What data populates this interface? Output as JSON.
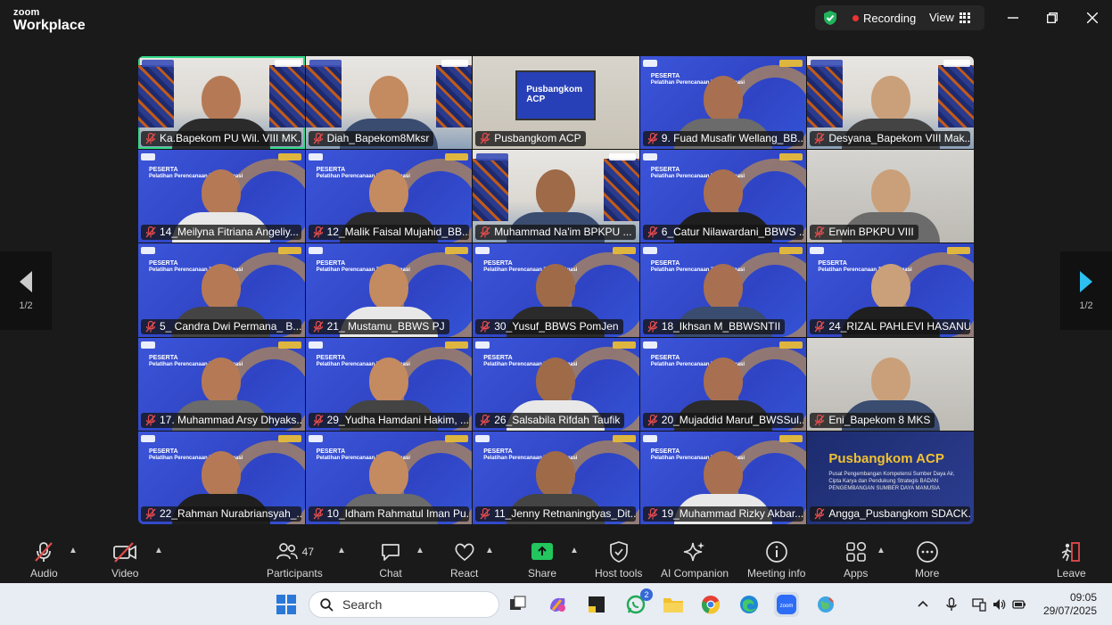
{
  "app": {
    "brand_top": "zoom",
    "brand_bottom": "Workplace"
  },
  "header": {
    "recording_label": "Recording",
    "view_label": "View"
  },
  "pager": {
    "left_page": "1/2",
    "right_page": "1/2"
  },
  "participants": [
    {
      "name": "Ka.Bapekom PU Wil. VIII MK...",
      "bg": "batik",
      "active": true,
      "host": true
    },
    {
      "name": "Diah_Bapekom8Mksr",
      "bg": "batik"
    },
    {
      "name": "Pusbangkom ACP",
      "bg": "room"
    },
    {
      "name": "9. Fuad Musafir Wellang_BB...",
      "bg": "blue"
    },
    {
      "name": "Desyana_Bapekom VIII Mak...",
      "bg": "batik"
    },
    {
      "name": "14_Meilyna Fitriana Angeliy...",
      "bg": "blue"
    },
    {
      "name": "12_Malik Faisal Mujahid_BB...",
      "bg": "blue"
    },
    {
      "name": "Muhammad Na'im BPKPU ...",
      "bg": "batik"
    },
    {
      "name": "6_Catur Nilawardani_BBWS ...",
      "bg": "blue"
    },
    {
      "name": "Erwin BPKPU VIII",
      "bg": "gray"
    },
    {
      "name": "5_ Candra Dwi Permana_ B...",
      "bg": "blue"
    },
    {
      "name": "21_ Mustamu_BBWS PJ",
      "bg": "blue"
    },
    {
      "name": "30_Yusuf_BBWS PomJen",
      "bg": "blue"
    },
    {
      "name": "18_Ikhsan M_BBWSNTII",
      "bg": "blue"
    },
    {
      "name": "24_RIZAL PAHLEVI HASANU...",
      "bg": "blue"
    },
    {
      "name": "17. Muhammad Arsy Dhyaks...",
      "bg": "blue"
    },
    {
      "name": "29_Yudha Hamdani Hakim, ...",
      "bg": "blue"
    },
    {
      "name": "26_Salsabila Rifdah Taufik",
      "bg": "blue"
    },
    {
      "name": "20_Mujaddid Maruf_BWSSul...",
      "bg": "blue"
    },
    {
      "name": "Eni_Bapekom 8 MKS",
      "bg": "gray"
    },
    {
      "name": "22_Rahman Nurabriansyah_...",
      "bg": "blue"
    },
    {
      "name": "10_Idham Rahmatul Iman Pu...",
      "bg": "blue"
    },
    {
      "name": "11_Jenny Retnaningtyas_Dit...",
      "bg": "blue"
    },
    {
      "name": "19_Muhammad Rizky Akbar...",
      "bg": "blue"
    },
    {
      "name": "Angga_Pusbangkom SDACK...",
      "bg": "pus"
    }
  ],
  "tile_text": {
    "peserta": "PESERTA",
    "pelatihan": "Pelatihan Perencanaan Teknis Irigasi",
    "acp_screen": "Pusbangkom ACP",
    "pus_title_a": "Pusbangkom ",
    "pus_title_b": "ACP",
    "pus_sub": "Pusat Pengembangan Kompetensi Sumber Daya Air, Cipta Karya dan Pendukung Strategis BADAN PENGEMBANGAN SUMBER DAYA MANUSIA"
  },
  "toolbar": {
    "audio": "Audio",
    "video": "Video",
    "participants": "Participants",
    "participant_count": "47",
    "chat": "Chat",
    "react": "React",
    "share": "Share",
    "host_tools": "Host tools",
    "ai_companion": "AI Companion",
    "meeting_info": "Meeting info",
    "apps": "Apps",
    "more": "More",
    "leave": "Leave"
  },
  "taskbar": {
    "search_placeholder": "Search",
    "whatsapp_badge": "2",
    "time": "09:05",
    "date": "29/07/2025"
  },
  "colors": {
    "active_border": "#31d98a",
    "recording_dot": "#e33333",
    "leave": "#e24c4c",
    "share": "#22c55e"
  }
}
